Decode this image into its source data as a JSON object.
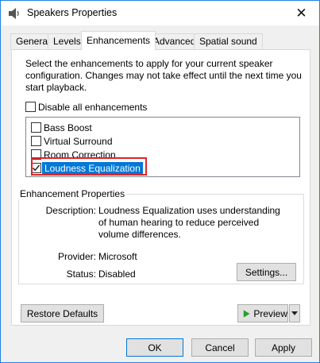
{
  "window": {
    "title": "Speakers Properties",
    "close_symbol": "✕"
  },
  "tabs": [
    {
      "label": "General"
    },
    {
      "label": "Levels"
    },
    {
      "label": "Enhancements"
    },
    {
      "label": "Advanced"
    },
    {
      "label": "Spatial sound"
    }
  ],
  "active_tab": "Enhancements",
  "instructions": "Select the enhancements to apply for your current speaker configuration. Changes may not take effect until the next time you start playback.",
  "disable_all": {
    "label": "Disable all enhancements",
    "checked": false
  },
  "enhancements": [
    {
      "label": "Bass Boost",
      "checked": false
    },
    {
      "label": "Virtual Surround",
      "checked": false
    },
    {
      "label": "Room Correction",
      "checked": false
    },
    {
      "label": "Loudness Equalization",
      "checked": true,
      "selected": true
    }
  ],
  "properties": {
    "title": "Enhancement Properties",
    "description_label": "Description:",
    "description": "Loudness Equalization uses understanding of human hearing to reduce perceived volume differences.",
    "provider_label": "Provider:",
    "provider": "Microsoft",
    "status_label": "Status:",
    "status": "Disabled",
    "settings_button": "Settings..."
  },
  "buttons": {
    "restore_defaults": "Restore Defaults",
    "preview": "Preview",
    "ok": "OK",
    "cancel": "Cancel",
    "apply": "Apply"
  },
  "colors": {
    "accent": "#0078d7",
    "highlight_border": "#e2232a",
    "preview_play": "#2a9d2a"
  }
}
